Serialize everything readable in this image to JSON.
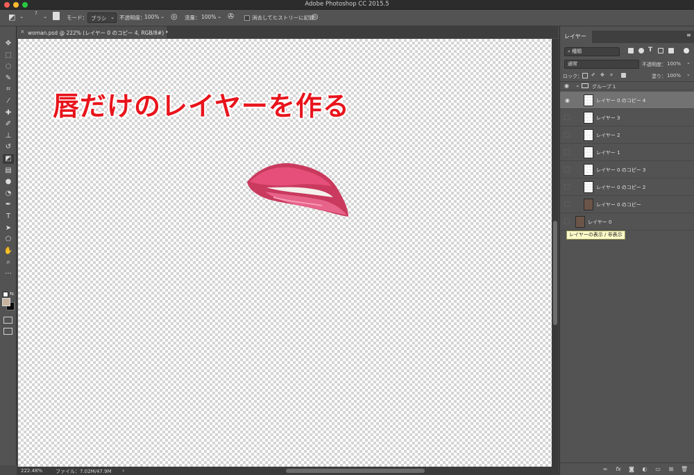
{
  "app": {
    "title": "Adobe Photoshop CC 2015.5"
  },
  "window": {
    "close_color": "#fc5f57",
    "min_color": "#fdbc2e",
    "max_color": "#28c840"
  },
  "options": {
    "brush_size": "7",
    "mode_label": "モード：",
    "mode_value": "ブラシ",
    "opacity_label": "不透明度：",
    "opacity_value": "100%",
    "flow_label": "流量：",
    "flow_value": "100%",
    "history_label": "消去してヒストリーに記録"
  },
  "document": {
    "tab_title": "woman.psd @ 222% (レイヤー 0 のコピー 4, RGB/8#) *",
    "headline": "唇だけのレイヤーを作る"
  },
  "status": {
    "zoom": "222.48%",
    "file": "ファイル：7.02M/47.9M",
    "arrow": "›"
  },
  "tools": [
    {
      "name": "move-tool-icon",
      "glyph": "✥"
    },
    {
      "name": "marquee-tool-icon",
      "glyph": "⬚"
    },
    {
      "name": "lasso-tool-icon",
      "glyph": "◌"
    },
    {
      "name": "quick-select-tool-icon",
      "glyph": "✎"
    },
    {
      "name": "crop-tool-icon",
      "glyph": "⌗"
    },
    {
      "name": "eyedropper-tool-icon",
      "glyph": "⁄"
    },
    {
      "name": "healing-tool-icon",
      "glyph": "✚"
    },
    {
      "name": "brush-tool-icon",
      "glyph": "✐"
    },
    {
      "name": "stamp-tool-icon",
      "glyph": "⊥"
    },
    {
      "name": "history-brush-tool-icon",
      "glyph": "↺"
    },
    {
      "name": "eraser-tool-icon",
      "glyph": "◩"
    },
    {
      "name": "gradient-tool-icon",
      "glyph": "▤"
    },
    {
      "name": "blur-tool-icon",
      "glyph": "●"
    },
    {
      "name": "dodge-tool-icon",
      "glyph": "◔"
    },
    {
      "name": "pen-tool-icon",
      "glyph": "✒"
    },
    {
      "name": "type-tool-icon",
      "glyph": "T"
    },
    {
      "name": "path-select-tool-icon",
      "glyph": "➤"
    },
    {
      "name": "shape-tool-icon",
      "glyph": "⬠"
    },
    {
      "name": "hand-tool-icon",
      "glyph": "✋"
    },
    {
      "name": "zoom-tool-icon",
      "glyph": "⌕"
    },
    {
      "name": "more-tools-icon",
      "glyph": "···"
    }
  ],
  "panel": {
    "tab_label": "レイヤー",
    "filter_kind": "種類",
    "blend_mode": "通常",
    "opacity_label": "不透明度：",
    "opacity_value": "100%",
    "lock_label": "ロック：",
    "fill_label": "塗り：",
    "fill_value": "100%"
  },
  "layers": [
    {
      "name": "グループ 1",
      "kind": "group",
      "visible": true,
      "selected": false
    },
    {
      "name": "レイヤー 0 のコピー 4",
      "kind": "layer",
      "visible": true,
      "selected": true,
      "thumb": "blank"
    },
    {
      "name": "レイヤー 3",
      "kind": "layer",
      "visible": false,
      "selected": false,
      "thumb": "blank"
    },
    {
      "name": "レイヤー 2",
      "kind": "layer",
      "visible": false,
      "selected": false,
      "thumb": "blank"
    },
    {
      "name": "レイヤー 1",
      "kind": "layer",
      "visible": false,
      "selected": false,
      "thumb": "blank"
    },
    {
      "name": "レイヤー 0 のコピー 3",
      "kind": "layer",
      "visible": false,
      "selected": false,
      "thumb": "blank"
    },
    {
      "name": "レイヤー 0 のコピー 2",
      "kind": "layer",
      "visible": false,
      "selected": false,
      "thumb": "blank"
    },
    {
      "name": "レイヤー 0 のコピー",
      "kind": "layer",
      "visible": false,
      "selected": false,
      "thumb": "photo"
    },
    {
      "name": "レイヤー 0",
      "kind": "base",
      "visible": false,
      "selected": false,
      "thumb": "photo"
    }
  ],
  "tooltip": "レイヤーの表示 / 非表示"
}
